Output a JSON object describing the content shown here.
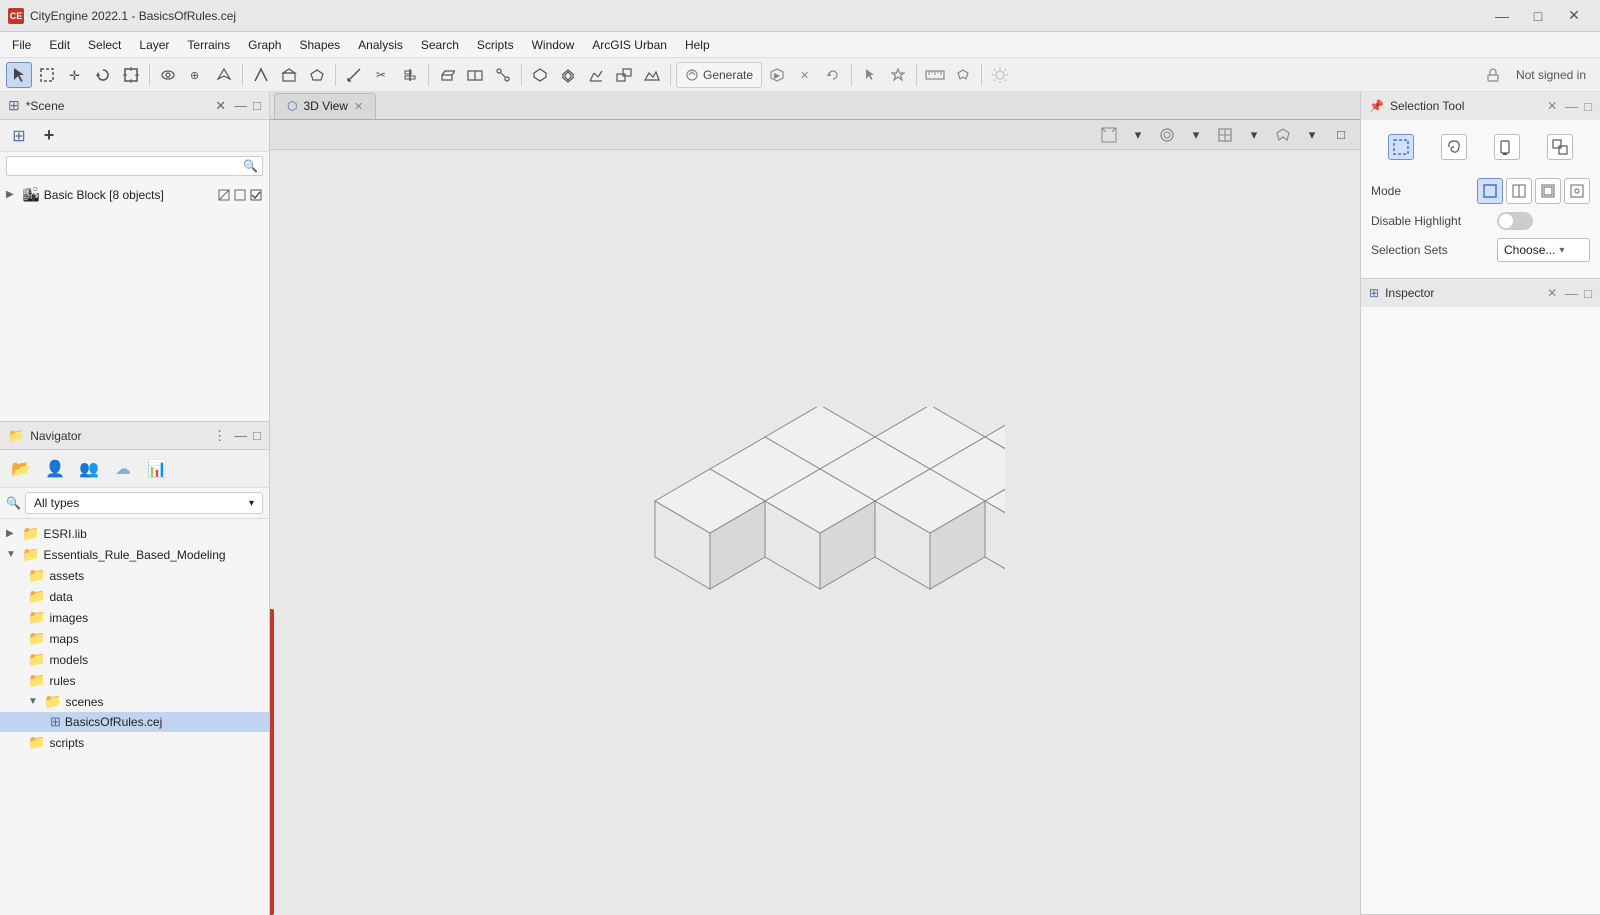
{
  "app": {
    "title": "CityEngine 2022.1 - BasicsOfRules.cej",
    "icon": "CE"
  },
  "window_controls": {
    "minimize": "—",
    "maximize": "□",
    "close": "✕"
  },
  "menu": {
    "items": [
      "File",
      "Edit",
      "Select",
      "Layer",
      "Terrains",
      "Graph",
      "Shapes",
      "Analysis",
      "Search",
      "Scripts",
      "Window",
      "ArcGIS Urban",
      "Help"
    ]
  },
  "scene_panel": {
    "title": "*Scene",
    "search_placeholder": "",
    "group_name": "Basic Block [8 objects]"
  },
  "navigator_panel": {
    "title": "Navigator",
    "filter_label": "All types",
    "items": [
      {
        "type": "folder",
        "label": "ESRI.lib",
        "indent": 0,
        "expanded": false
      },
      {
        "type": "folder",
        "label": "Essentials_Rule_Based_Modeling",
        "indent": 0,
        "expanded": true
      },
      {
        "type": "folder",
        "label": "assets",
        "indent": 1
      },
      {
        "type": "folder",
        "label": "data",
        "indent": 1
      },
      {
        "type": "folder",
        "label": "images",
        "indent": 1
      },
      {
        "type": "folder",
        "label": "maps",
        "indent": 1
      },
      {
        "type": "folder",
        "label": "models",
        "indent": 1
      },
      {
        "type": "folder",
        "label": "rules",
        "indent": 1
      },
      {
        "type": "folder",
        "label": "scenes",
        "indent": 1,
        "expanded": true
      },
      {
        "type": "file",
        "label": "BasicsOfRules.cej",
        "indent": 2,
        "selected": true
      },
      {
        "type": "folder",
        "label": "scripts",
        "indent": 1
      }
    ]
  },
  "view_3d": {
    "tab_label": "3D View"
  },
  "selection_tool": {
    "title": "Selection Tool",
    "mode_label": "Mode",
    "disable_highlight_label": "Disable Highlight",
    "selection_sets_label": "Selection Sets",
    "selection_sets_placeholder": "Choose...",
    "mode_buttons": [
      "rect-select",
      "lasso-select",
      "paint-select",
      "deselect"
    ],
    "toggle_state": "off"
  },
  "inspector": {
    "title": "Inspector"
  },
  "toolbar": {
    "generate_label": "Generate",
    "not_signed_in": "Not signed in"
  }
}
